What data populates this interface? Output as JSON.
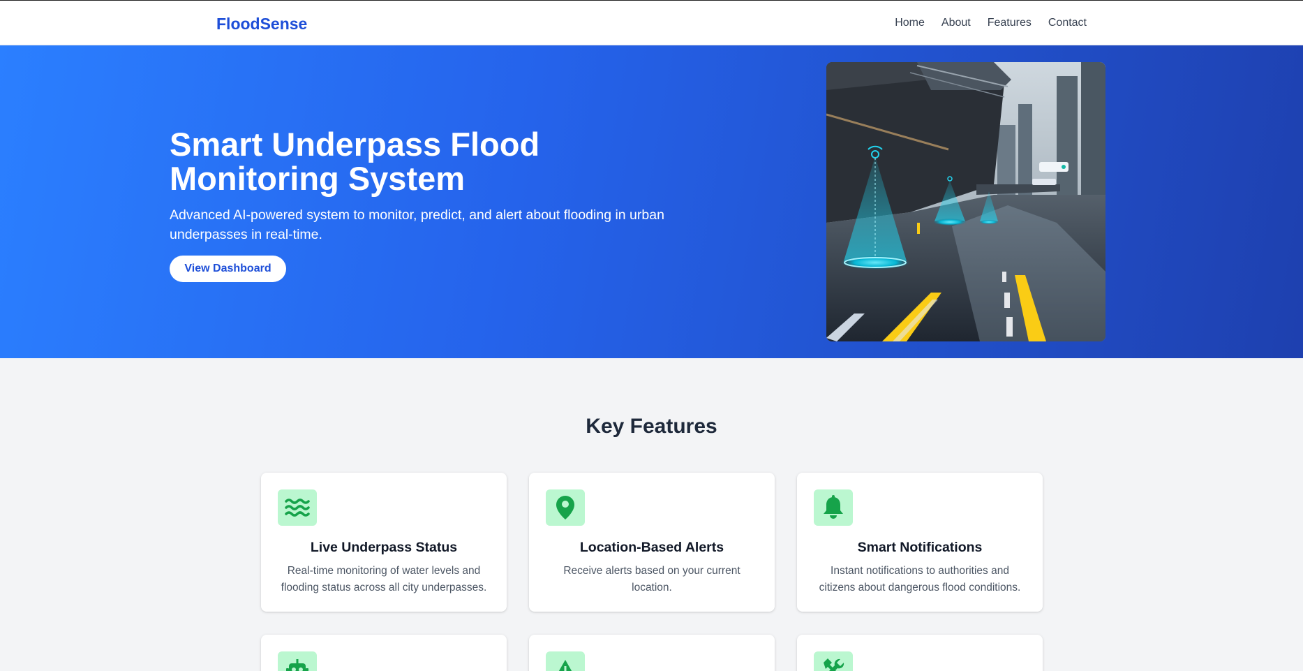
{
  "nav": {
    "brand": "FloodSense",
    "links": [
      "Home",
      "About",
      "Features",
      "Contact"
    ]
  },
  "hero": {
    "title": "Smart Underpass Flood Monitoring System",
    "subtitle": "Advanced AI-powered system to monitor, predict, and alert about flooding in urban underpasses in real-time.",
    "button_label": "View Dashboard",
    "image_icon": "flooded-underpass-with-sensors-image"
  },
  "features": {
    "heading": "Key Features",
    "cards": [
      {
        "icon": "water-waves-icon",
        "title": "Live Underpass Status",
        "description": "Real-time monitoring of water levels and flooding status across all city underpasses."
      },
      {
        "icon": "map-pin-icon",
        "title": "Location-Based Alerts",
        "description": "Receive alerts based on your current location."
      },
      {
        "icon": "bell-icon",
        "title": "Smart Notifications",
        "description": "Instant notifications to authorities and citizens about dangerous flood conditions."
      },
      {
        "icon": "robot-icon"
      },
      {
        "icon": "warning-triangle-icon"
      },
      {
        "icon": "tools-icon"
      }
    ],
    "accent_color": "#16a34a",
    "icon_bg_color": "#bbf7d0"
  },
  "colors": {
    "brand": "#1d4ed8",
    "hero_gradient_start": "#2b7fff",
    "hero_gradient_end": "#1e40af"
  }
}
